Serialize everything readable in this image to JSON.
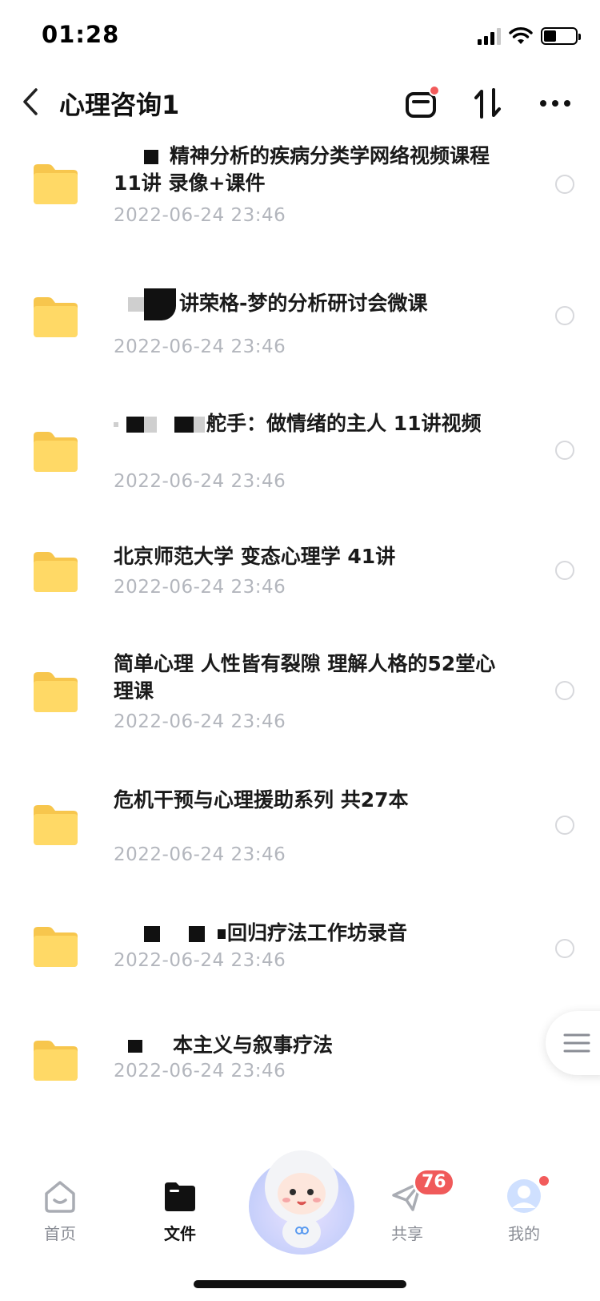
{
  "status_bar": {
    "time": "01:28"
  },
  "nav": {
    "title": "心理咨询1"
  },
  "files": [
    {
      "name_parts": [
        "精神分析的疾病分类学网络视频课程11讲 录像+课件"
      ],
      "date": "2022-06-24 23:46"
    },
    {
      "name_parts": [
        "讲荣格-梦的分析研讨会微课"
      ],
      "date": "2022-06-24 23:46"
    },
    {
      "name_parts": [
        "舵手：做情绪的主人 11讲视频"
      ],
      "date": "2022-06-24 23:46"
    },
    {
      "name_parts": [
        "北京师范大学 变态心理学 41讲"
      ],
      "date": "2022-06-24 23:46"
    },
    {
      "name_parts": [
        "简单心理 人性皆有裂隙 理解人格的52堂心理课"
      ],
      "date": "2022-06-24 23:46"
    },
    {
      "name_parts": [
        "危机干预与心理援助系列 共27本"
      ],
      "date": "2022-06-24 23:46"
    },
    {
      "name_parts": [
        "回归疗法工作坊录音"
      ],
      "date": "2022-06-24 23:46"
    },
    {
      "name_parts": [
        "本主义与叙事疗法"
      ],
      "date": "2022-06-24 23:46"
    }
  ],
  "tab_bar": {
    "home": "首页",
    "files": "文件",
    "share": "共享",
    "share_badge": "76",
    "mine": "我的"
  },
  "colors": {
    "folder": "#ffd766",
    "badge": "#f05a5a",
    "date_text": "#b3b6bd"
  }
}
